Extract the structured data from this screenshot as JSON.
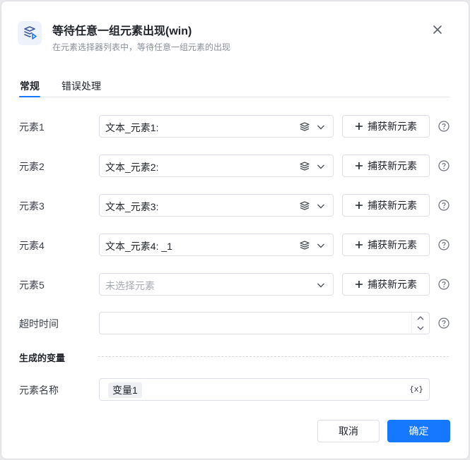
{
  "dialog": {
    "title": "等待任意一组元素出现(win)",
    "subtitle": "在元素选择器列表中，等待任意一组元素的出现",
    "logo_icon": "element-stack-icon",
    "close_icon": "close-icon"
  },
  "tabs": [
    {
      "label": "常规",
      "active": true
    },
    {
      "label": "错误处理",
      "active": false
    }
  ],
  "elements": [
    {
      "label": "元素1",
      "value": "文本_元素1:",
      "placeholder": false
    },
    {
      "label": "元素2",
      "value": "文本_元素2:",
      "placeholder": false
    },
    {
      "label": "元素3",
      "value": "文本_元素3:",
      "placeholder": false
    },
    {
      "label": "元素4",
      "value": "文本_元素4: _1",
      "placeholder": false
    },
    {
      "label": "元素5",
      "value": "未选择元素",
      "placeholder": true
    }
  ],
  "capture_label": "捕获新元素",
  "timeout": {
    "label": "超时时间",
    "value": ""
  },
  "output_section": {
    "title": "生成的变量"
  },
  "variable": {
    "label": "元素名称",
    "tag": "变量1",
    "fx": "{x}"
  },
  "buttons": {
    "cancel": "取消",
    "confirm": "确定"
  },
  "colors": {
    "primary": "#1677ff",
    "border": "#dcdfe6"
  }
}
